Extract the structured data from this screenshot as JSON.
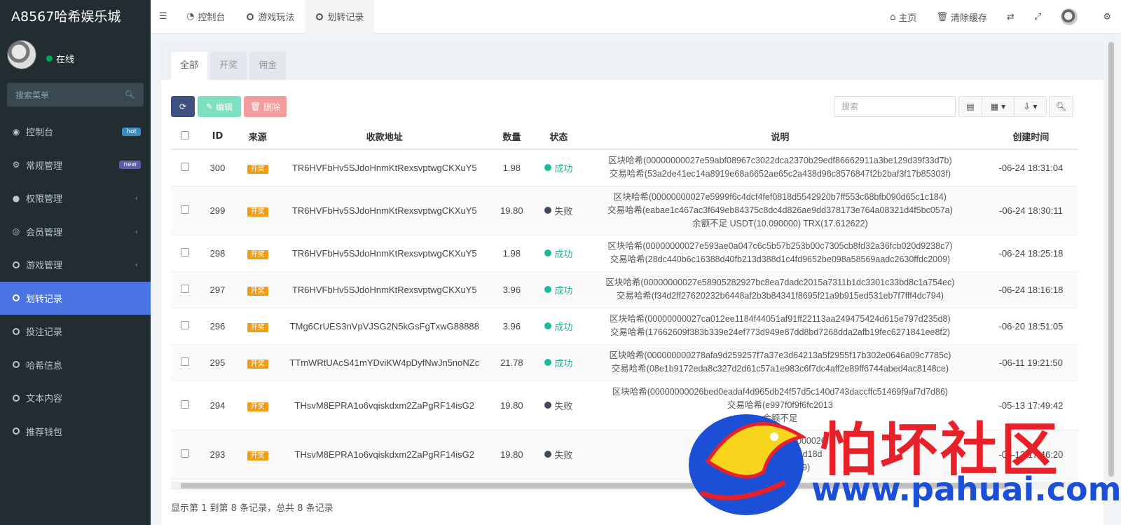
{
  "app": {
    "title": "A8567哈希娱乐城"
  },
  "user": {
    "status": "在线"
  },
  "sidebar": {
    "search_placeholder": "搜索菜单",
    "items": [
      {
        "label": "控制台",
        "icon": "dashboard-icon",
        "badge": "hot"
      },
      {
        "label": "常规管理",
        "icon": "cogs-icon",
        "badge": "new"
      },
      {
        "label": "权限管理",
        "icon": "users-icon",
        "has_children": true
      },
      {
        "label": "会员管理",
        "icon": "user-circle-icon",
        "has_children": true
      },
      {
        "label": "游戏管理",
        "icon": "circle-icon",
        "has_children": true
      },
      {
        "label": "划转记录",
        "icon": "circle-icon",
        "active": true
      },
      {
        "label": "投注记录",
        "icon": "circle-icon"
      },
      {
        "label": "哈希信息",
        "icon": "circle-icon"
      },
      {
        "label": "文本内容",
        "icon": "circle-icon"
      },
      {
        "label": "推荐钱包",
        "icon": "circle-icon"
      }
    ]
  },
  "topnav": {
    "tabs": [
      {
        "label": "控制台"
      },
      {
        "label": "游戏玩法"
      },
      {
        "label": "划转记录"
      }
    ],
    "right": {
      "home": "主页",
      "clear_cache": "清除缓存"
    }
  },
  "content": {
    "tabs": [
      "全部",
      "开奖",
      "佣金"
    ],
    "toolbar": {
      "edit": "编辑",
      "delete": "删除",
      "search_placeholder": "搜索"
    },
    "columns": [
      "ID",
      "来源",
      "收款地址",
      "数量",
      "状态",
      "说明",
      "创建时间"
    ],
    "rows": [
      {
        "id": "300",
        "source": "开奖",
        "address": "TR6HVFbHv5SJdoHnmKtRexsvptwgCKXuY5",
        "amount": "1.98",
        "status": "成功",
        "desc": [
          "区块哈希(00000000027e59abf08967c3022dca2370b29edf86662911a3be129d39f33d7b)",
          "交易哈希(53a2de41ec14a8919e68a6652ae65c2a438d96c8576847f2b2baf3f17b85303f)"
        ],
        "time": "-06-24 18:31:04"
      },
      {
        "id": "299",
        "source": "开奖",
        "address": "TR6HVFbHv5SJdoHnmKtRexsvptwgCKXuY5",
        "amount": "19.80",
        "status": "失败",
        "desc": [
          "区块哈希(00000000027e5999f6c4dcf4fef0818d5542920b7ff553c68bfb090d65c1c184)",
          "交易哈希(eabae1c467ac3f649eb84375c8dc4d826ae9dd378173e764a08321d4f5bc057a)",
          "余额不足 USDT(10.090000) TRX(17.612622)"
        ],
        "time": "-06-24 18:30:11"
      },
      {
        "id": "298",
        "source": "开奖",
        "address": "TR6HVFbHv5SJdoHnmKtRexsvptwgCKXuY5",
        "amount": "1.98",
        "status": "成功",
        "desc": [
          "区块哈希(00000000027e593ae0a047c6c5b57b253b00c7305cb8fd32a36fcb020d9238c7)",
          "交易哈希(28dc440b6c16388d40fb213d388d1c4fd9652be098a58569aadc2630ffdc2009)"
        ],
        "time": "-06-24 18:25:18"
      },
      {
        "id": "297",
        "source": "开奖",
        "address": "TR6HVFbHv5SJdoHnmKtRexsvptwgCKXuY5",
        "amount": "3.96",
        "status": "成功",
        "desc": [
          "区块哈希(00000000027e58905282927bc8ea7dadc2015a7311b1dc3301c33bd8c1a754ec)",
          "交易哈希(f34d2ff27620232b6448af2b3b84341f8695f21a9b915ed531eb7f7fff4dc794)"
        ],
        "time": "-06-24 18:16:18"
      },
      {
        "id": "296",
        "source": "开奖",
        "address": "TMg6CrUES3nVpVJSG2N5kGsFgTxwG88888",
        "amount": "3.96",
        "status": "成功",
        "desc": [
          "区块哈希(00000000027ca012ee1184f44051af91ff22113aa249475424d615e797d235d8)",
          "交易哈希(17662609f383b339e24ef773d949e87dd8bd7268dda2afb19fec6271841ee8f2)"
        ],
        "time": "-06-20 18:51:05"
      },
      {
        "id": "295",
        "source": "开奖",
        "address": "TTmWRtUAcS41mYDviKW4pDyfNwJn5noNZc",
        "amount": "21.78",
        "status": "成功",
        "desc": [
          "区块哈希(000000000278afa9d259257f7a37e3d64213a5f2955f17b302e0646a09c7785c)",
          "交易哈希(08e1b9172eda8c327d2d61c57a1e983c6f7dc4aff2e89ff6744abed4ac8148ce)"
        ],
        "time": "-06-11 19:21:50"
      },
      {
        "id": "294",
        "source": "开奖",
        "address": "THsvM8EPRA1o6vqiskdxm2ZaPgRF14isG2",
        "amount": "19.80",
        "status": "失败",
        "desc": [
          "区块哈希(00000000026bed0eadaf4d965db24f57d5c140d743daccffc51469f9af7d7d86)",
          "交易哈希(e997f0f9f6fc2013",
          "余额不足"
        ],
        "time": "-05-13 17:49:42"
      },
      {
        "id": "293",
        "source": "开奖",
        "address": "THsvM8EPRA1o6vqiskdxm2ZaPgRF14isG2",
        "amount": "19.80",
        "status": "失败",
        "desc": [
          "区块哈希(00000000026",
          "交易哈希(6af99ad18d",
          "TRX(7.614589)"
        ],
        "time": "-05-13 17:46:20"
      }
    ],
    "footer": "显示第 1 到第 8 条记录，总共 8 条记录"
  },
  "watermark": {
    "text": "怕坏社区",
    "url": "www.pahuai.com"
  }
}
